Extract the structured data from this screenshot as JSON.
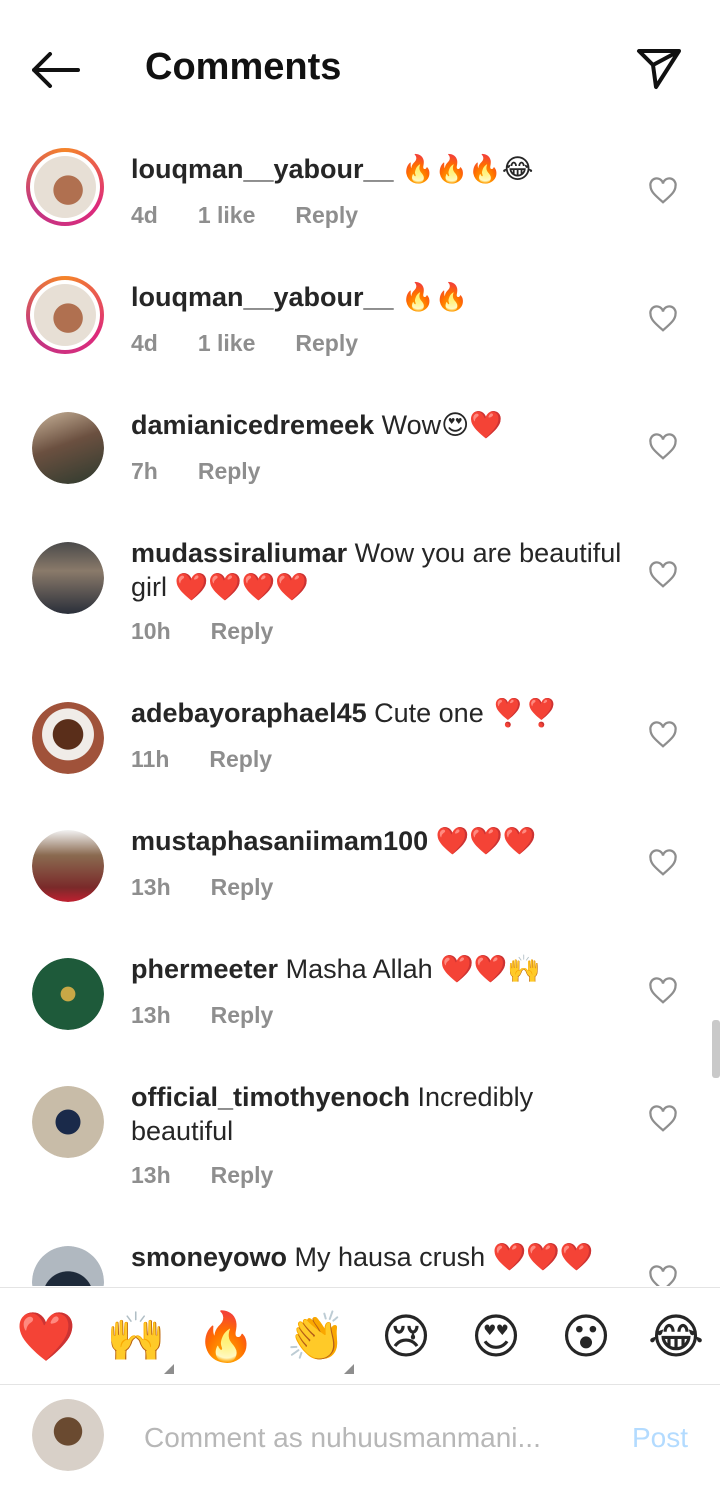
{
  "header": {
    "title": "Comments",
    "back_icon": "arrow-left-icon",
    "share_icon": "paper-plane-icon"
  },
  "comments": [
    {
      "username": "louqman__yabour__",
      "text": " 🔥🔥🔥😂",
      "time": "4d",
      "likes": "1 like",
      "reply": "Reply",
      "avatar_style": "ring-product"
    },
    {
      "username": "louqman__yabour__",
      "text": " 🔥🔥",
      "time": "4d",
      "likes": "1 like",
      "reply": "Reply",
      "avatar_style": "ring-product"
    },
    {
      "username": "damianicedremeek",
      "text": " Wow😍❤️",
      "time": "7h",
      "likes": "",
      "reply": "Reply",
      "avatar_style": "photo"
    },
    {
      "username": "mudassiraliumar",
      "text": " Wow you are beautiful girl ❤️❤️❤️❤️",
      "time": "10h",
      "likes": "",
      "reply": "Reply",
      "avatar_style": "photo"
    },
    {
      "username": "adebayoraphael45",
      "text": " Cute one ❣️❣️",
      "time": "11h",
      "likes": "",
      "reply": "Reply",
      "avatar_style": "photo"
    },
    {
      "username": "mustaphasaniimam100",
      "text": " ❤️❤️❤️",
      "time": "13h",
      "likes": "",
      "reply": "Reply",
      "avatar_style": "photo"
    },
    {
      "username": "phermeeter",
      "text": " Masha Allah ❤️❤️🙌",
      "time": "13h",
      "likes": "",
      "reply": "Reply",
      "avatar_style": "photo"
    },
    {
      "username": "official_timothyenoch",
      "text": " Incredibly beautiful",
      "time": "13h",
      "likes": "",
      "reply": "Reply",
      "avatar_style": "photo"
    },
    {
      "username": "smoneyowo",
      "text": " My hausa crush ❤️❤️❤️",
      "time": "",
      "likes": "",
      "reply": "",
      "avatar_style": "photo"
    }
  ],
  "reactions": [
    "❤️",
    "🙌",
    "🔥",
    "👏",
    "😢",
    "😍",
    "😮",
    "😂"
  ],
  "composer": {
    "placeholder": "Comment as nuhuusmanmani...",
    "post_label": "Post"
  },
  "colors": {
    "text": "#262626",
    "meta": "#8e8e8e",
    "post_disabled": "#b3dbff",
    "story_ring": "#dd2a7b"
  }
}
